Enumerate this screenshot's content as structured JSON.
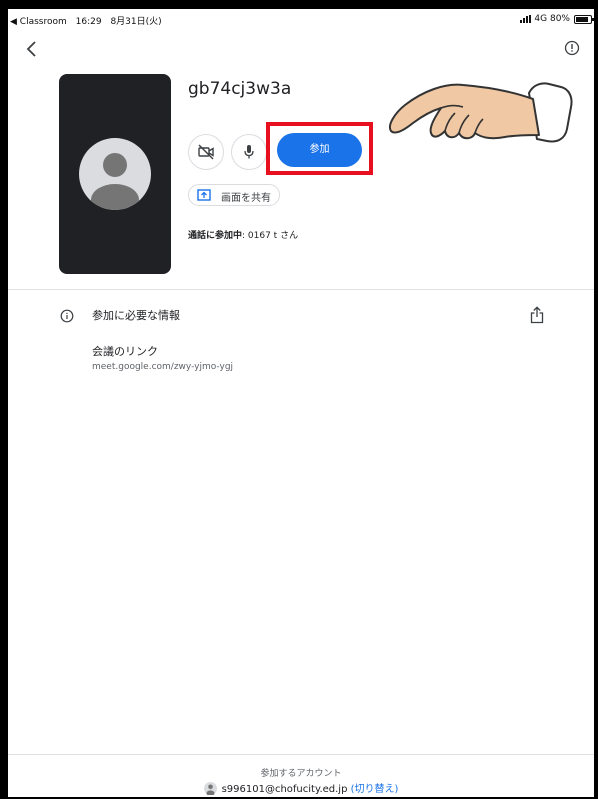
{
  "status_bar": {
    "back_app": "◀ Classroom",
    "time": "16:29",
    "date": "8月31日(火)",
    "network": "4G",
    "battery": "80%"
  },
  "meeting": {
    "code": "gb74cj3w3a",
    "join_label": "参加",
    "share_label": "画面を共有",
    "in_call_prefix": "通話に参加中",
    "in_call_rest": ": 0167 t さん"
  },
  "info": {
    "title": "参加に必要な情報",
    "link_label": "会議のリンク",
    "link_url": "meet.google.com/zwy-yjmo-ygj"
  },
  "account": {
    "label": "参加するアカウント",
    "email": "s996101@chofucity.ed.jp",
    "switch_prefix": " (",
    "switch_label": "切り替え",
    "switch_suffix": ")"
  },
  "colors": {
    "accent": "#1a73e8",
    "highlight": "#e8101e",
    "tile": "#202124"
  }
}
